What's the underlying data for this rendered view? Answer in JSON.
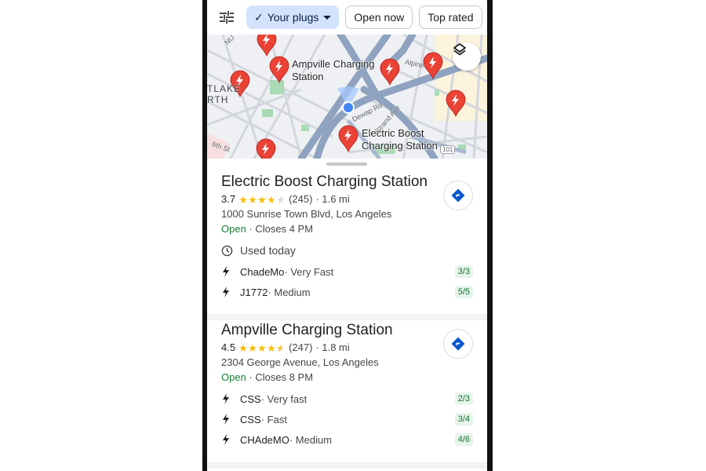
{
  "filters": {
    "settings_icon": "tune-icon",
    "chips": [
      {
        "label": "Your plugs",
        "selected": true,
        "has_check": true,
        "has_dropdown": true
      },
      {
        "label": "Open now",
        "selected": false
      },
      {
        "label": "Top rated",
        "selected": false
      }
    ]
  },
  "map": {
    "labels": {
      "ampville": [
        "Ampville Charging",
        "Station"
      ],
      "electric": [
        "Electric Boost",
        "Charging Station"
      ],
      "westlake": [
        "TLAKE",
        "RTH"
      ],
      "street_dewap": "Dewap Rd",
      "street_strand": "Strand Ave",
      "street_6th": "6th St",
      "street_alpine": "Alpine",
      "street_nu": "NU",
      "highway": "101"
    },
    "layers_icon": "layers-icon",
    "pin_color": "#ea4335",
    "location_dot_color": "#4285f4"
  },
  "results": [
    {
      "name": "Electric Boost Charging Station",
      "rating": "3.7",
      "rating_value": 3.7,
      "reviews": "(245)",
      "distance": "· 1.6 mi",
      "address": "1000 Sunrise Town Blvd, Los Angeles",
      "status": "Open",
      "hours": " · Closes 4 PM",
      "used_today": "Used today",
      "plugs": [
        {
          "type": "ChadeMo",
          "speed": " · Very Fast",
          "availability": "3/3"
        },
        {
          "type": "J1772",
          "speed": " · Medium",
          "availability": "5/5"
        }
      ]
    },
    {
      "name": "Ampville Charging Station",
      "rating": "4.5",
      "rating_value": 4.5,
      "reviews": "(247)",
      "distance": "· 1.8 mi",
      "address": "2304 George Avenue, Los Angeles",
      "status": "Open",
      "hours": " · Closes 8 PM",
      "plugs": [
        {
          "type": "CSS",
          "speed": " · Very fast",
          "availability": "2/3"
        },
        {
          "type": "CSS",
          "speed": " · Fast",
          "availability": "3/4"
        },
        {
          "type": "CHAdeMO",
          "speed": " · Medium",
          "availability": "4/6"
        }
      ]
    }
  ],
  "colors": {
    "selected_chip_bg": "#d3e3fd",
    "open_green": "#188038",
    "star_yellow": "#fbbc04",
    "directions_blue": "#0b57d0",
    "availability_bg": "#e6f4ea"
  }
}
